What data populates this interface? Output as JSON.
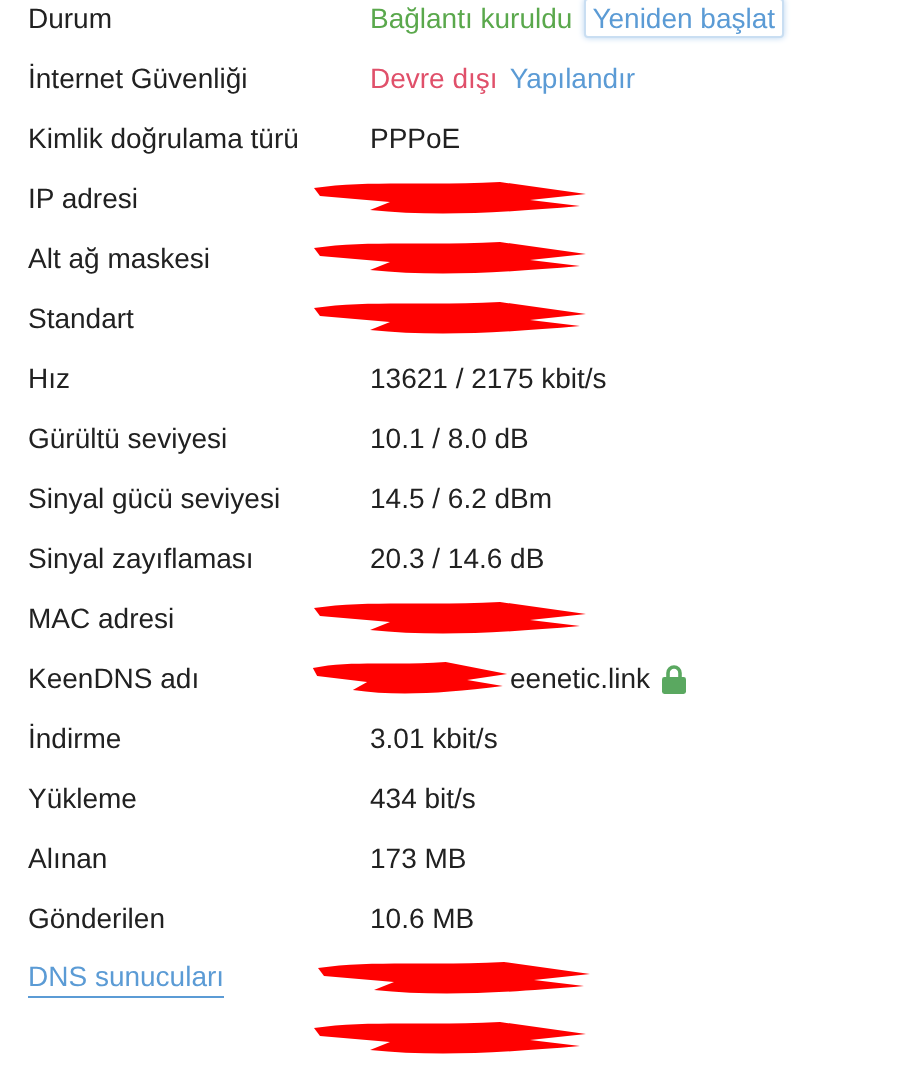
{
  "rows": [
    {
      "label": "Durum",
      "values": [
        {
          "kind": "success",
          "text": "Bağlantı kuruldu"
        },
        {
          "kind": "button",
          "text": "Yeniden başlat"
        }
      ]
    },
    {
      "label": "İnternet Güvenliği",
      "values": [
        {
          "kind": "danger",
          "text": "Devre dışı"
        },
        {
          "kind": "link",
          "text": "Yapılandır"
        }
      ]
    },
    {
      "label": "Kimlik doğrulama türü",
      "values": [
        {
          "kind": "text",
          "text": "PPPoE"
        }
      ]
    },
    {
      "label": "IP adresi",
      "values": [
        {
          "kind": "redacted"
        }
      ]
    },
    {
      "label": "Alt ağ maskesi",
      "values": [
        {
          "kind": "redacted"
        }
      ]
    },
    {
      "label": "Standart",
      "values": [
        {
          "kind": "redacted"
        }
      ]
    },
    {
      "label": "Hız",
      "values": [
        {
          "kind": "text",
          "text": "13621 / 2175 kbit/s"
        }
      ]
    },
    {
      "label": "Gürültü seviyesi",
      "values": [
        {
          "kind": "text",
          "text": "10.1 / 8.0 dB"
        }
      ]
    },
    {
      "label": "Sinyal gücü seviyesi",
      "values": [
        {
          "kind": "text",
          "text": "14.5 / 6.2 dBm"
        }
      ]
    },
    {
      "label": "Sinyal zayıflaması",
      "values": [
        {
          "kind": "text",
          "text": "20.3 / 14.6 dB"
        }
      ]
    },
    {
      "label": "MAC adresi",
      "values": [
        {
          "kind": "redacted"
        }
      ]
    },
    {
      "label": "KeenDNS adı",
      "values": [
        {
          "kind": "redacted"
        },
        {
          "kind": "text",
          "text": "eenetic.link"
        },
        {
          "kind": "lock"
        }
      ]
    },
    {
      "label": "İndirme",
      "values": [
        {
          "kind": "text",
          "text": "3.01 kbit/s"
        }
      ]
    },
    {
      "label": "Yükleme",
      "values": [
        {
          "kind": "text",
          "text": "434 bit/s"
        }
      ]
    },
    {
      "label": "Alınan",
      "values": [
        {
          "kind": "text",
          "text": "173 MB"
        }
      ]
    },
    {
      "label": "Gönderilen",
      "values": [
        {
          "kind": "text",
          "text": "10.6 MB"
        }
      ]
    },
    {
      "label": "DNS sunucuları",
      "kind": "link",
      "values": [
        {
          "kind": "redacted"
        }
      ]
    },
    {
      "values": [
        {
          "kind": "redacted"
        }
      ]
    }
  ]
}
